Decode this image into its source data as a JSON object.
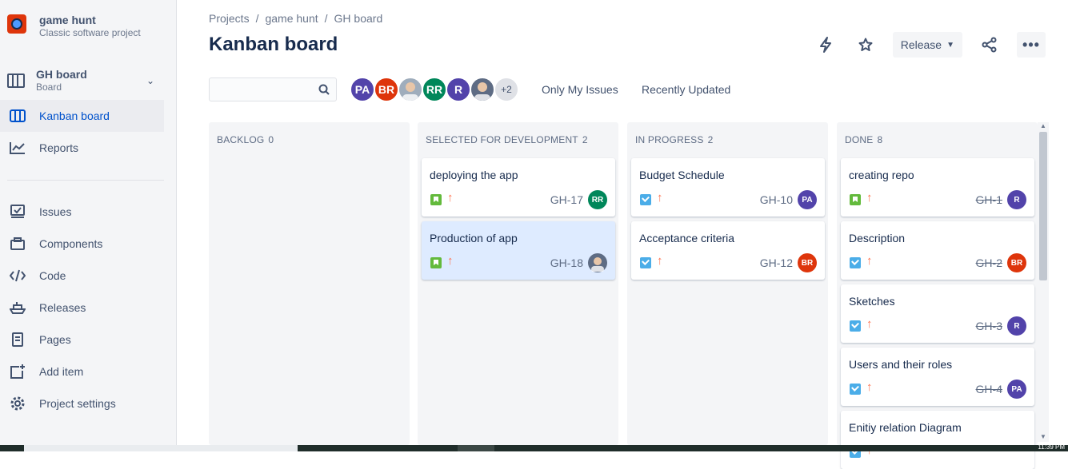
{
  "project": {
    "name": "game hunt",
    "type": "Classic software project"
  },
  "board_selector": {
    "name": "GH board",
    "type": "Board"
  },
  "sidebar": {
    "items": [
      {
        "label": "Kanban board",
        "icon": "board-icon",
        "active": true
      },
      {
        "label": "Reports",
        "icon": "chart-icon"
      },
      {
        "label": "Issues",
        "icon": "issues-icon"
      },
      {
        "label": "Components",
        "icon": "components-icon"
      },
      {
        "label": "Code",
        "icon": "code-icon"
      },
      {
        "label": "Releases",
        "icon": "ship-icon"
      },
      {
        "label": "Pages",
        "icon": "page-icon"
      },
      {
        "label": "Add item",
        "icon": "add-item-icon"
      },
      {
        "label": "Project settings",
        "icon": "gear-icon"
      }
    ]
  },
  "breadcrumb": [
    "Projects",
    "game hunt",
    "GH board"
  ],
  "page_title": "Kanban board",
  "header_actions": {
    "release_label": "Release"
  },
  "search": {
    "placeholder": ""
  },
  "avatars": [
    {
      "initials": "PA",
      "color": "#5243aa"
    },
    {
      "initials": "BR",
      "color": "#de350b"
    },
    {
      "initials": "",
      "photo": true
    },
    {
      "initials": "RR",
      "color": "#00875a"
    },
    {
      "initials": "R",
      "color": "#5243aa"
    },
    {
      "initials": "",
      "photo": true
    },
    {
      "initials": "+2",
      "more": true
    }
  ],
  "filters": [
    "Only My Issues",
    "Recently Updated"
  ],
  "columns": [
    {
      "title": "BACKLOG",
      "count": "0",
      "cards": []
    },
    {
      "title": "SELECTED FOR DEVELOPMENT",
      "count": "2",
      "cards": [
        {
          "title": "deploying the app",
          "type": "story",
          "key": "GH-17",
          "assignee": "RR",
          "avatar_color": "#00875a",
          "done": false
        },
        {
          "title": "Production of app",
          "type": "story",
          "key": "GH-18",
          "assignee": "",
          "avatar_color": "#5e6c84",
          "done": false,
          "selected": true
        }
      ]
    },
    {
      "title": "IN PROGRESS",
      "count": "2",
      "cards": [
        {
          "title": "Budget Schedule",
          "type": "task",
          "key": "GH-10",
          "assignee": "PA",
          "avatar_color": "#5243aa",
          "done": false
        },
        {
          "title": "Acceptance criteria",
          "type": "task",
          "key": "GH-12",
          "assignee": "BR",
          "avatar_color": "#de350b",
          "done": false
        }
      ]
    },
    {
      "title": "DONE",
      "count": "8",
      "cards": [
        {
          "title": "creating repo",
          "type": "story",
          "key": "GH-1",
          "assignee": "R",
          "avatar_color": "#5243aa",
          "done": true
        },
        {
          "title": "Description",
          "type": "task",
          "key": "GH-2",
          "assignee": "BR",
          "avatar_color": "#de350b",
          "done": true
        },
        {
          "title": "Sketches",
          "type": "task",
          "key": "GH-3",
          "assignee": "R",
          "avatar_color": "#5243aa",
          "done": true
        },
        {
          "title": "Users and their roles",
          "type": "task",
          "key": "GH-4",
          "assignee": "PA",
          "avatar_color": "#5243aa",
          "done": true
        },
        {
          "title": "Enitiy relation Diagram",
          "type": "task",
          "key": "",
          "assignee": "",
          "avatar_color": "",
          "done": true
        }
      ]
    }
  ],
  "taskbar": {
    "clock": "11:39 PM"
  }
}
